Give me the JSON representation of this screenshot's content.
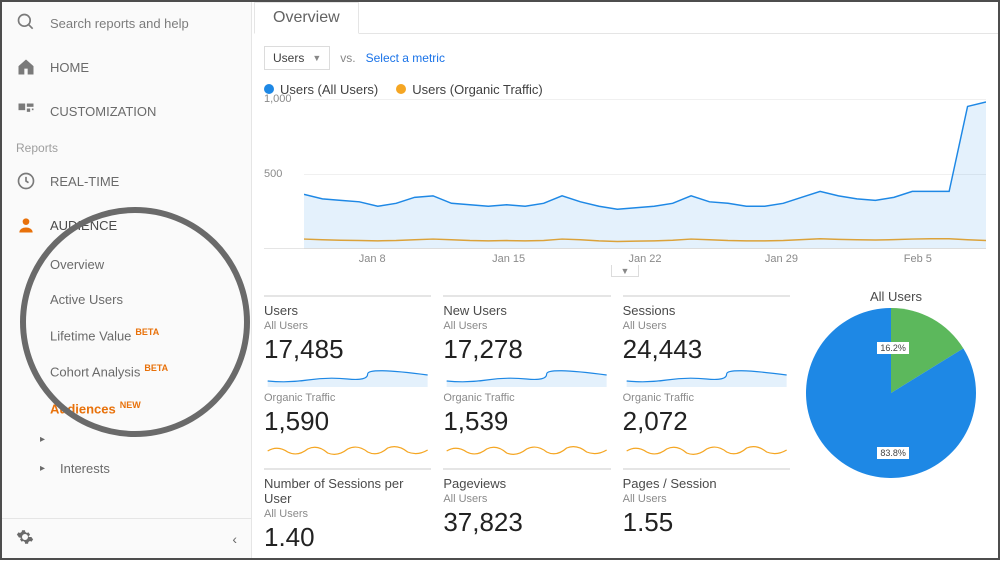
{
  "search": {
    "placeholder": "Search reports and help"
  },
  "sidebar": {
    "home": "HOME",
    "customization": "CUSTOMIZATION",
    "reports_label": "Reports",
    "realtime": "REAL-TIME",
    "audience": "AUDIENCE",
    "items": [
      {
        "label": "Overview"
      },
      {
        "label": "Active Users"
      },
      {
        "label": "Lifetime Value",
        "badge": "BETA"
      },
      {
        "label": "Cohort Analysis",
        "badge": "BETA"
      },
      {
        "label": "Audiences",
        "badge": "NEW",
        "active": true
      }
    ],
    "interests": "Interests"
  },
  "tab": "Overview",
  "controls": {
    "metric_dropdown": "Users",
    "vs": "vs.",
    "select_metric": "Select a metric"
  },
  "legend": {
    "series_a": "Users (All Users)",
    "series_b": "Users (Organic Traffic)"
  },
  "chart_data": {
    "type": "line",
    "ylim": [
      0,
      1000
    ],
    "yticks": [
      1000,
      500
    ],
    "x_labels": [
      "Jan 8",
      "Jan 15",
      "Jan 22",
      "Jan 29",
      "Feb 5"
    ],
    "series": [
      {
        "name": "Users (All Users)",
        "color": "#1e88e5",
        "values": [
          360,
          330,
          320,
          310,
          280,
          300,
          340,
          350,
          300,
          290,
          280,
          290,
          280,
          300,
          350,
          310,
          280,
          260,
          270,
          280,
          300,
          350,
          310,
          300,
          280,
          280,
          300,
          340,
          380,
          350,
          330,
          320,
          340,
          380,
          380,
          380,
          950,
          980
        ]
      },
      {
        "name": "Users (Organic Traffic)",
        "color": "#f5a623",
        "values": [
          60,
          55,
          52,
          50,
          48,
          50,
          55,
          60,
          55,
          50,
          48,
          50,
          48,
          50,
          60,
          55,
          48,
          44,
          46,
          48,
          52,
          60,
          55,
          50,
          48,
          48,
          50,
          56,
          62,
          58,
          55,
          54,
          56,
          60,
          62,
          62,
          55,
          50
        ]
      }
    ]
  },
  "cards": [
    {
      "title": "Users",
      "all_label": "All Users",
      "all_value": "17,485",
      "org_label": "Organic Traffic",
      "org_value": "1,590"
    },
    {
      "title": "New Users",
      "all_label": "All Users",
      "all_value": "17,278",
      "org_label": "Organic Traffic",
      "org_value": "1,539"
    },
    {
      "title": "Sessions",
      "all_label": "All Users",
      "all_value": "24,443",
      "org_label": "Organic Traffic",
      "org_value": "2,072"
    },
    {
      "title": "Number of Sessions per User",
      "all_label": "All Users",
      "all_value": "1.40"
    },
    {
      "title": "Pageviews",
      "all_label": "All Users",
      "all_value": "37,823"
    },
    {
      "title": "Pages / Session",
      "all_label": "All Users",
      "all_value": "1.55"
    }
  ],
  "pie": {
    "title": "All Users",
    "slice_a": 83.8,
    "slice_b": 16.2,
    "label_a": "83.8%",
    "label_b": "16.2%",
    "color_a": "#1e88e5",
    "color_b": "#5cb85c"
  },
  "yticks": {
    "a": "1,000",
    "b": "500"
  }
}
